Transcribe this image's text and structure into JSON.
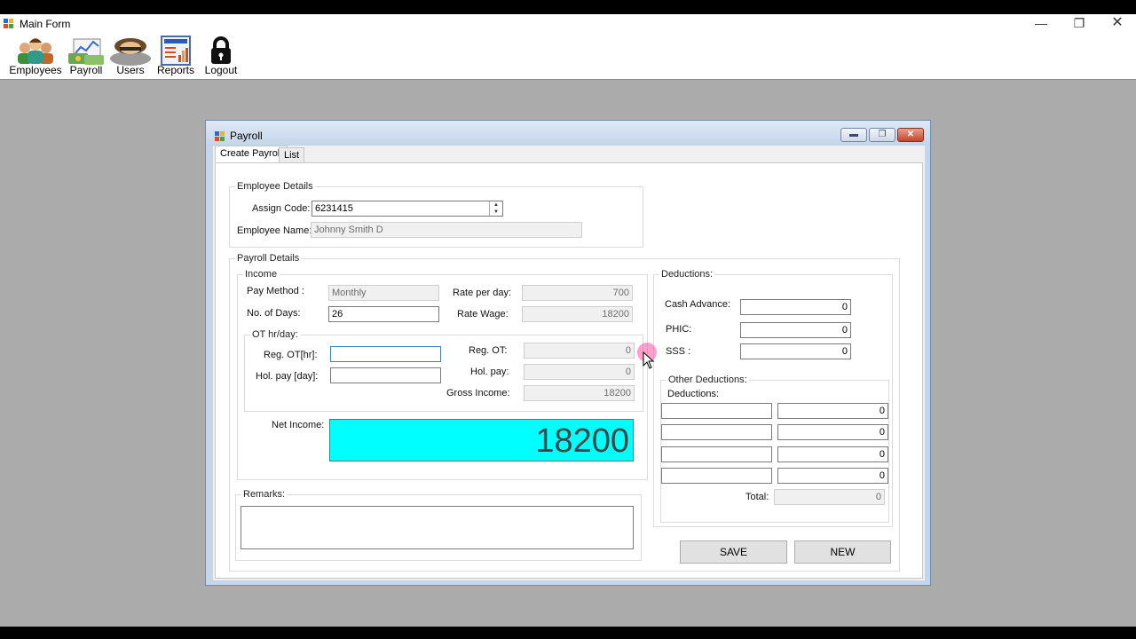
{
  "main_window": {
    "title": "Main Form",
    "toolbar": [
      {
        "label": "Employees",
        "icon": "employees-icon"
      },
      {
        "label": "Payroll",
        "icon": "payroll-icon"
      },
      {
        "label": "Users",
        "icon": "users-icon"
      },
      {
        "label": "Reports",
        "icon": "reports-icon"
      },
      {
        "label": "Logout",
        "icon": "lock-icon"
      }
    ]
  },
  "payroll_window": {
    "title": "Payroll",
    "tabs": [
      {
        "label": "Create Payroll",
        "active": true
      },
      {
        "label": "List",
        "active": false
      }
    ],
    "employee_details": {
      "title": "Employee Details",
      "assign_code_label": "Assign Code:",
      "assign_code_value": "6231415",
      "employee_name_label": "Employee Name:",
      "employee_name_value": "Johnny Smith D"
    },
    "payroll_details": {
      "title": "Payroll Details",
      "income": {
        "title": "Income",
        "pay_method_label": "Pay Method :",
        "pay_method_value": "Monthly",
        "no_days_label": "No. of Days:",
        "no_days_value": "26",
        "rate_per_day_label": "Rate per day:",
        "rate_per_day_value": "700",
        "rate_wage_label": "Rate Wage:",
        "rate_wage_value": "18200",
        "ot": {
          "title": "OT hr/day:",
          "reg_ot_hr_label": "Reg. OT[hr]:",
          "reg_ot_hr_value": "",
          "hol_pay_day_label": "Hol. pay [day]:",
          "hol_pay_day_value": "",
          "reg_ot_label": "Reg. OT:",
          "reg_ot_value": "0",
          "hol_pay_label": "Hol. pay:",
          "hol_pay_value": "0",
          "gross_income_label": "Gross Income:",
          "gross_income_value": "18200"
        },
        "net_income_label": "Net Income:",
        "net_income_value": "18200"
      },
      "remarks": {
        "title": "Remarks:",
        "value": ""
      },
      "deductions": {
        "title": "Deductions:",
        "cash_advance_label": "Cash Advance:",
        "cash_advance_value": "0",
        "phic_label": "PHIC:",
        "phic_value": "0",
        "sss_label": "SSS :",
        "sss_value": "0",
        "other": {
          "title": "Other Deductions:",
          "subtitle": "Deductions:",
          "rows": [
            {
              "name": "",
              "amount": "0"
            },
            {
              "name": "",
              "amount": "0"
            },
            {
              "name": "",
              "amount": "0"
            },
            {
              "name": "",
              "amount": "0"
            }
          ],
          "total_label": "Total:",
          "total_value": "0"
        }
      },
      "save_label": "SAVE",
      "new_label": "NEW"
    }
  },
  "colors": {
    "net_income_bg": "#00ffff",
    "titlebar": "#c6d6ea",
    "desktop": "#ababab"
  }
}
